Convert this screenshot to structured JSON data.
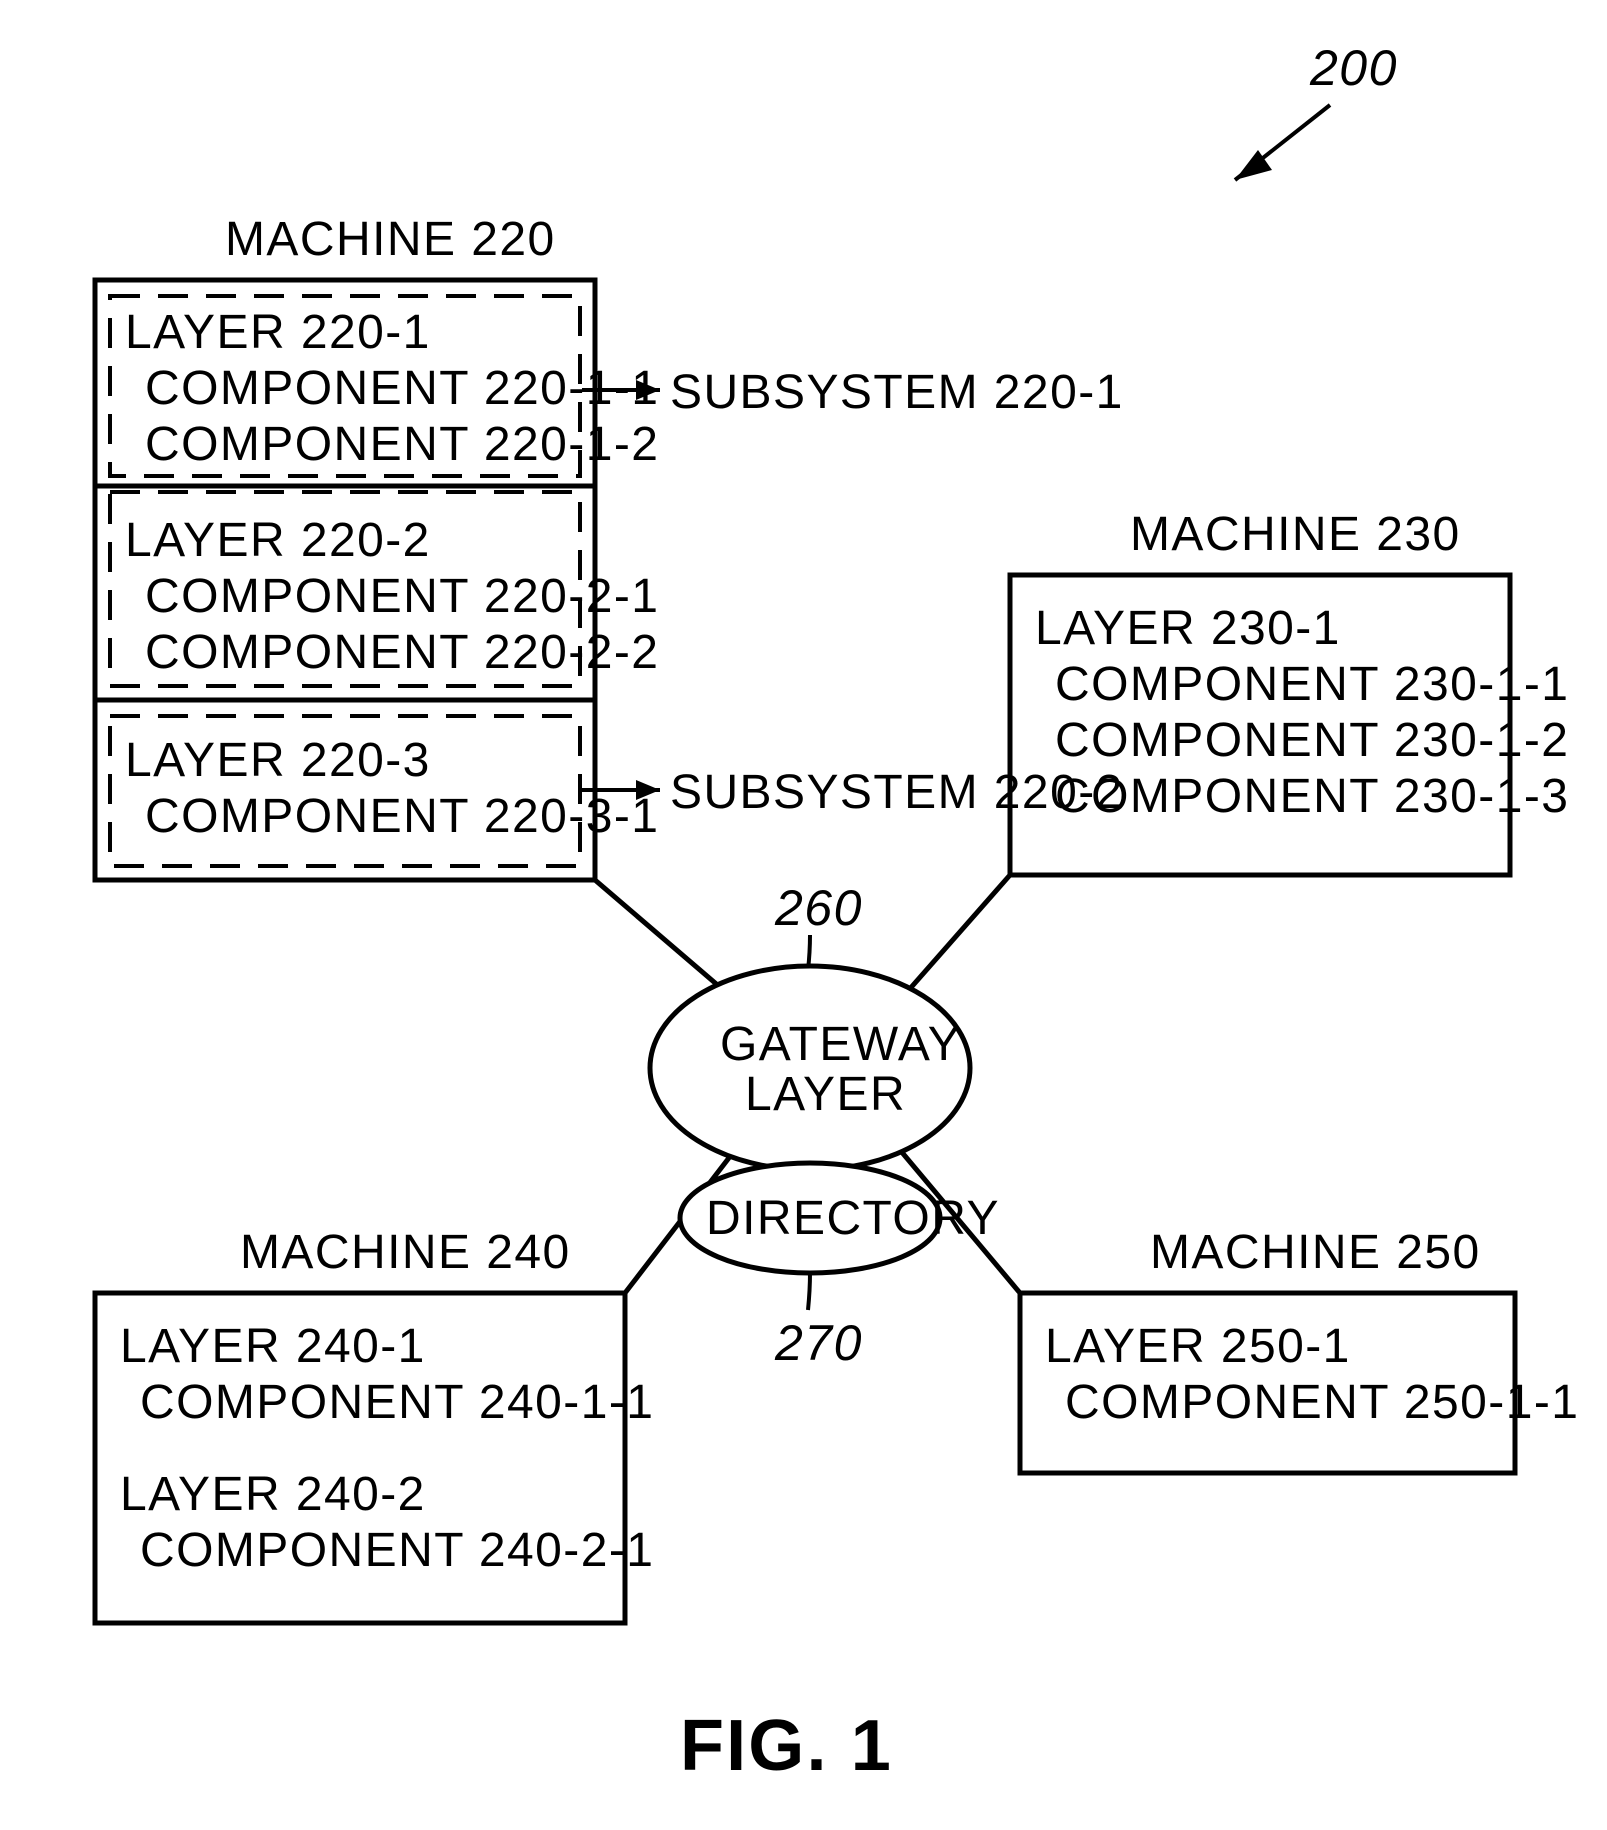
{
  "figure": {
    "caption": "FIG.  1",
    "reference_numeral": "200"
  },
  "machines": {
    "m220": {
      "title": "MACHINE 220",
      "layers": [
        {
          "name": "LAYER 220-1",
          "components": [
            "COMPONENT 220-1-1",
            "COMPONENT 220-1-2"
          ]
        },
        {
          "name": "LAYER 220-2",
          "components": [
            "COMPONENT 220-2-1",
            "COMPONENT 220-2-2"
          ]
        },
        {
          "name": "LAYER 220-3",
          "components": [
            "COMPONENT 220-3-1"
          ]
        }
      ],
      "subsystems": [
        "SUBSYSTEM 220-1",
        "SUBSYSTEM 220-2"
      ]
    },
    "m230": {
      "title": "MACHINE 230",
      "layers": [
        {
          "name": "LAYER 230-1",
          "components": [
            "COMPONENT 230-1-1",
            "COMPONENT 230-1-2",
            "COMPONENT 230-1-3"
          ]
        }
      ]
    },
    "m240": {
      "title": "MACHINE 240",
      "layers": [
        {
          "name": "LAYER 240-1",
          "components": [
            "COMPONENT 240-1-1"
          ]
        },
        {
          "name": "LAYER 240-2",
          "components": [
            "COMPONENT 240-2-1"
          ]
        }
      ]
    },
    "m250": {
      "title": "MACHINE 250",
      "layers": [
        {
          "name": "LAYER 250-1",
          "components": [
            "COMPONENT 250-1-1"
          ]
        }
      ]
    }
  },
  "gateway": {
    "label_line1": "GATEWAY",
    "label_line2": "LAYER",
    "ref": "260"
  },
  "directory": {
    "label": "DIRECTORY",
    "ref": "270"
  }
}
